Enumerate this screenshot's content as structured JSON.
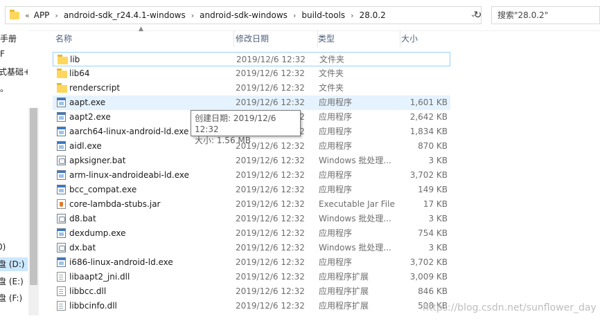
{
  "address_bar": {
    "lead": "«",
    "crumbs": [
      "APP",
      "android-sdk_r24.4.1-windows",
      "android-sdk-windows",
      "build-tools",
      "28.0.2"
    ],
    "sep": "›",
    "dropdown": "⌄"
  },
  "refresh_glyph": "↻",
  "search": {
    "placeholder": "搜索\"28.0.2\""
  },
  "nav": {
    "items": [
      "手册",
      "F",
      "式基础+功",
      "。",
      "0)",
      "盘 (D:)",
      "盘 (E:)",
      "盘 (F:)"
    ],
    "selected_index": 5
  },
  "columns": {
    "name": "名称",
    "date": "修改日期",
    "type": "类型",
    "size": "大小"
  },
  "files": [
    {
      "icon": "folder-icon",
      "name": "lib",
      "date": "2019/12/6 12:32",
      "type": "文件夹",
      "size": ""
    },
    {
      "icon": "folder-icon",
      "name": "lib64",
      "date": "2019/12/6 12:32",
      "type": "文件夹",
      "size": ""
    },
    {
      "icon": "folder-icon",
      "name": "renderscript",
      "date": "2019/12/6 12:32",
      "type": "文件夹",
      "size": ""
    },
    {
      "icon": "exe-icon",
      "name": "aapt.exe",
      "date": "2019/12/6 12:32",
      "type": "应用程序",
      "size": "1,601 KB"
    },
    {
      "icon": "exe-icon",
      "name": "aapt2.exe",
      "date": "2019/12/6 12:32",
      "type": "应用程序",
      "size": "2,642 KB"
    },
    {
      "icon": "exe-icon",
      "name": "aarch64-linux-android-ld.exe",
      "date": "2019/12/6 12:32",
      "type": "应用程序",
      "size": "1,834 KB"
    },
    {
      "icon": "exe-icon",
      "name": "aidl.exe",
      "date": "2019/12/6 12:32",
      "type": "应用程序",
      "size": "870 KB"
    },
    {
      "icon": "bat-icon",
      "name": "apksigner.bat",
      "date": "2019/12/6 12:32",
      "type": "Windows 批处理...",
      "size": "3 KB"
    },
    {
      "icon": "exe-icon",
      "name": "arm-linux-androideabi-ld.exe",
      "date": "2019/12/6 12:32",
      "type": "应用程序",
      "size": "3,702 KB"
    },
    {
      "icon": "exe-icon",
      "name": "bcc_compat.exe",
      "date": "2019/12/6 12:32",
      "type": "应用程序",
      "size": "149 KB"
    },
    {
      "icon": "jar-icon",
      "name": "core-lambda-stubs.jar",
      "date": "2019/12/6 12:32",
      "type": "Executable Jar File",
      "size": "17 KB"
    },
    {
      "icon": "bat-icon",
      "name": "d8.bat",
      "date": "2019/12/6 12:32",
      "type": "Windows 批处理...",
      "size": "3 KB"
    },
    {
      "icon": "exe-icon",
      "name": "dexdump.exe",
      "date": "2019/12/6 12:32",
      "type": "应用程序",
      "size": "754 KB"
    },
    {
      "icon": "bat-icon",
      "name": "dx.bat",
      "date": "2019/12/6 12:32",
      "type": "Windows 批处理...",
      "size": "3 KB"
    },
    {
      "icon": "exe-icon",
      "name": "i686-linux-android-ld.exe",
      "date": "2019/12/6 12:32",
      "type": "应用程序",
      "size": "3,702 KB"
    },
    {
      "icon": "dll-icon",
      "name": "libaapt2_jni.dll",
      "date": "2019/12/6 12:32",
      "type": "应用程序扩展",
      "size": "3,009 KB"
    },
    {
      "icon": "dll-icon",
      "name": "libbcc.dll",
      "date": "2019/12/6 12:32",
      "type": "应用程序扩展",
      "size": "846 KB"
    },
    {
      "icon": "dll-icon",
      "name": "libbcinfo.dll",
      "date": "2019/12/6 12:32",
      "type": "应用程序扩展",
      "size": "508 KB"
    }
  ],
  "tooltip": {
    "created": "创建日期: 2019/12/6 12:32",
    "size": "大小: 1.56 MB"
  },
  "watermark": "https://blog.csdn.net/sunflower_day",
  "colors": {
    "hover_row": "#e5f3ff",
    "outline_row": "#99d1ff",
    "selected_nav": "#cce8ff",
    "header_text": "#4c607a"
  }
}
